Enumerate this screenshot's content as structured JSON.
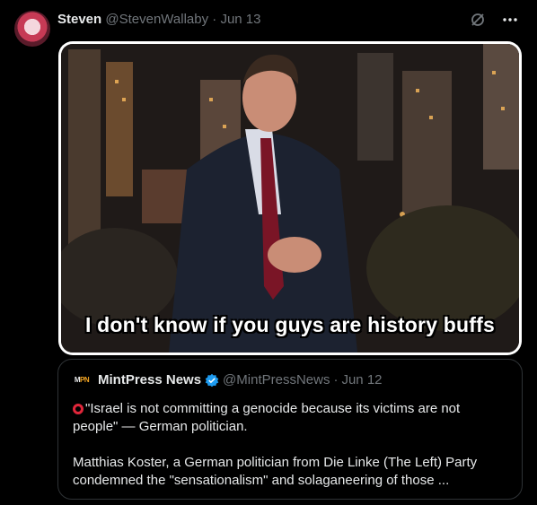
{
  "tweet": {
    "display_name": "Steven",
    "handle": "@StevenWallaby",
    "separator": "·",
    "date": "Jun 13",
    "media_caption": "I don't know if you guys are history buffs",
    "icons": [
      "grok-icon",
      "more-icon"
    ]
  },
  "quoted_tweet": {
    "logo_text_1": "M",
    "logo_text_2": "PN",
    "display_name": "MintPress News",
    "handle": "@MintPressNews",
    "separator": "·",
    "date": "Jun 12",
    "verified_color": "#1d9bf0",
    "line1": "\"Israel is not committing a genocide because its victims are not people\" — German politician.",
    "line2": "Matthias Koster, a German politician from Die Linke (The Left) Party condemned the \"sensationalism\" and solaganeering of those ..."
  },
  "colors": {
    "background": "#000000",
    "text_primary": "#e7e9ea",
    "text_secondary": "#71767b",
    "border": "#2f3336",
    "ring_red": "#e0263a"
  }
}
